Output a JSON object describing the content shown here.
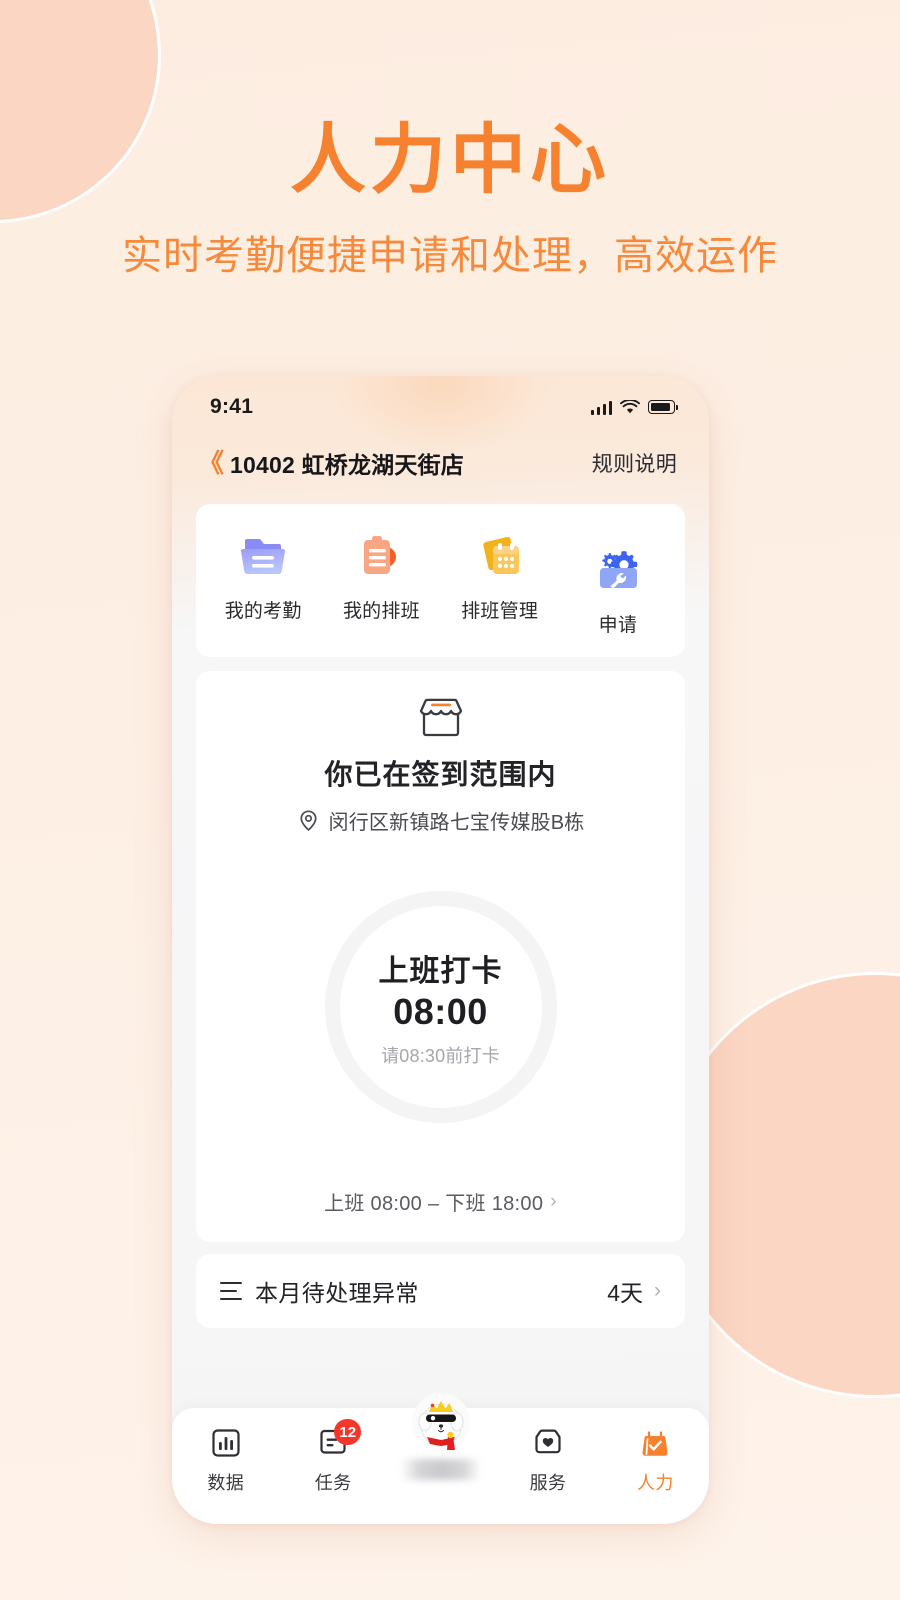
{
  "hero": {
    "title": "人力中心",
    "subtitle": "实时考勤便捷申请和处理，高效运作",
    "accent_color": "#F6812F"
  },
  "phone": {
    "status_bar": {
      "time": "9:41",
      "signal_icon": "cellular-signal-icon",
      "wifi_icon": "wifi-icon",
      "battery_icon": "battery-icon"
    },
    "app_header": {
      "back_icon": "double-chevron-left-icon",
      "store_title": "10402 虹桥龙湖天街店",
      "rules_link": "规则说明"
    },
    "quick_actions": [
      {
        "label": "我的考勤",
        "icon": "folder-icon",
        "color": "#8A8CF0"
      },
      {
        "label": "我的排班",
        "icon": "clipboard-icon",
        "color": "#F6865A"
      },
      {
        "label": "排班管理",
        "icon": "calendar-icon",
        "color": "#F5B526"
      },
      {
        "label": "申请",
        "icon": "gear-wrench-icon",
        "color": "#5C7CF5"
      }
    ],
    "checkin_card": {
      "store_icon": "storefront-icon",
      "title": "你已在签到范围内",
      "location_icon": "location-pin-icon",
      "address": "闵行区新镇路七宝传媒股B栋",
      "punch": {
        "label": "上班打卡",
        "time": "08:00",
        "hint": "请08:30前打卡",
        "ring_color": "#F4F4F5"
      },
      "shift_summary": "上班 08:00 – 下班 18:00",
      "shift_chevron": "chevron-right-icon"
    },
    "anomaly_row": {
      "list_icon": "list-lines-icon",
      "label": "本月待处理异常",
      "value": "4天",
      "chevron": "chevron-right-icon"
    },
    "tab_bar": {
      "tabs": [
        {
          "label": "数据",
          "icon": "bar-chart-icon",
          "active": false,
          "badge": ""
        },
        {
          "label": "任务",
          "icon": "document-icon",
          "active": false,
          "badge": "12"
        },
        {
          "label": "",
          "icon": "mascot-dog-icon",
          "active": false,
          "badge": ""
        },
        {
          "label": "服务",
          "icon": "box-heart-icon",
          "active": false,
          "badge": ""
        },
        {
          "label": "人力",
          "icon": "bag-check-icon",
          "active": true,
          "badge": ""
        }
      ],
      "active_color": "#F6812F",
      "badge_color": "#F5372B"
    }
  }
}
